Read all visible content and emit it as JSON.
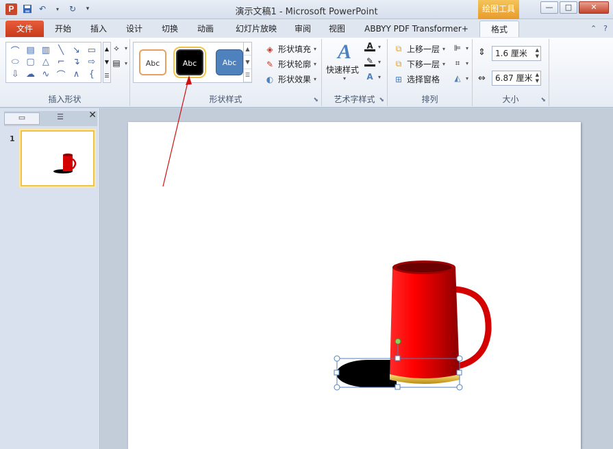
{
  "app": {
    "title": "演示文稿1 - Microsoft PowerPoint",
    "tools_tag": "绘图工具",
    "icon_letter": "P",
    "window_controls": [
      "—",
      "□",
      "✕"
    ]
  },
  "tabs": [
    {
      "label": "文件"
    },
    {
      "label": "开始"
    },
    {
      "label": "插入"
    },
    {
      "label": "设计"
    },
    {
      "label": "切换"
    },
    {
      "label": "动画"
    },
    {
      "label": "幻灯片放映"
    },
    {
      "label": "审阅"
    },
    {
      "label": "视图"
    },
    {
      "label": "ABBYY PDF Transformer+"
    },
    {
      "label": "格式"
    }
  ],
  "ribbon": {
    "insert_shapes": {
      "label": "插入形状"
    },
    "shape_styles": {
      "label": "形状样式",
      "style_samples": [
        "Abc",
        "Abc",
        "Abc"
      ],
      "fill": "形状填充",
      "outline": "形状轮廓",
      "effects": "形状效果"
    },
    "wordart": {
      "label": "艺术字样式",
      "quick_styles": "快速样式"
    },
    "arrange": {
      "label": "排列",
      "bring_forward": "上移一层",
      "send_backward": "下移一层",
      "selection_pane": "选择窗格"
    },
    "size": {
      "label": "大小",
      "height": "1.6 厘米",
      "width": "6.87 厘米"
    }
  },
  "slides_panel": {
    "slide_number": "1"
  },
  "colors": {
    "accent_file": "#c73a1c",
    "mug_red": "#e00000",
    "selection": "#4f81bd"
  }
}
